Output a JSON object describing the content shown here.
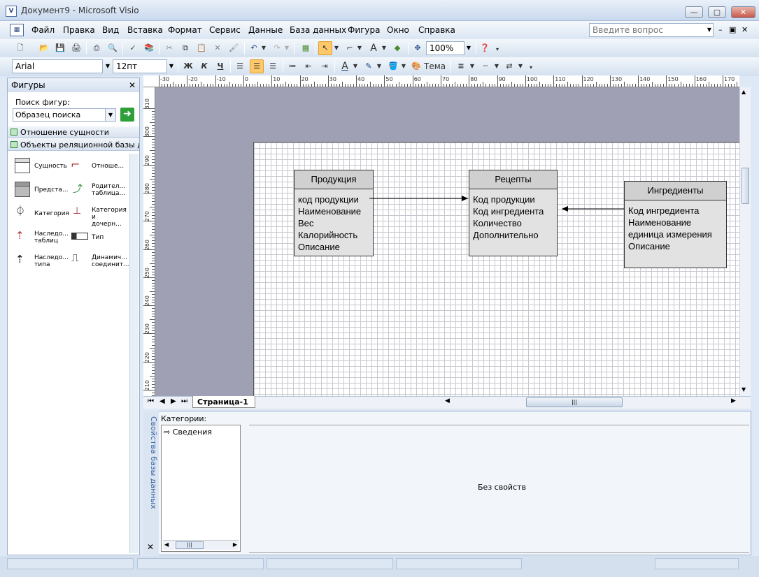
{
  "window": {
    "title": "Документ9 - Microsoft Visio",
    "min": "—",
    "max": "▢",
    "close": "✕"
  },
  "menu": {
    "items": [
      "Файл",
      "Правка",
      "Вид",
      "Вставка",
      "Формат",
      "Сервис",
      "Данные",
      "База данных",
      "Фигура",
      "Окно",
      "Справка"
    ],
    "help_placeholder": "Введите вопрос"
  },
  "toolbar": {
    "zoom": "100%"
  },
  "format_toolbar": {
    "font": "Arial",
    "size": "12пт",
    "bold": "Ж",
    "italic": "К",
    "underline": "Ч",
    "theme": "Тема"
  },
  "shapes_panel": {
    "title": "Фигуры",
    "search_label": "Поиск фигур:",
    "search_value": "Образец поиска",
    "stencils": [
      "Отношение сущности",
      "Объекты реляционной базы да..."
    ],
    "items": [
      [
        "Сущность",
        "Отноше..."
      ],
      [
        "Предста...",
        "Родител... таблица..."
      ],
      [
        "Категория",
        "Категория и дочерн..."
      ],
      [
        "Наследо... таблиц",
        "Тип"
      ],
      [
        "Наследо... типа",
        "Динамич... соединит..."
      ]
    ]
  },
  "ruler": {
    "h": [
      "-30",
      "-20",
      "-10",
      "0",
      "10",
      "20",
      "30",
      "40",
      "50",
      "60",
      "70",
      "80",
      "90",
      "100",
      "110",
      "120",
      "130",
      "140",
      "150",
      "160",
      "170"
    ],
    "v": [
      "310",
      "300",
      "290",
      "280",
      "270",
      "260",
      "250",
      "240",
      "230",
      "220",
      "210"
    ]
  },
  "diagram": {
    "entities": [
      {
        "name": "Продукция",
        "fields": [
          "код продукции",
          "Наименование",
          "Вес",
          "Калорийность",
          "Описание"
        ]
      },
      {
        "name": "Рецепты",
        "fields": [
          "Код продукции",
          "Код ингредиента",
          "Количество",
          "Дополнительно"
        ]
      },
      {
        "name": "Ингредиенты",
        "fields": [
          "Код ингредиента",
          "Наименование",
          "единица измерения",
          "Описание"
        ]
      }
    ]
  },
  "page_tab": "Страница-1",
  "db_properties": {
    "vertical_title": "Свойства базы данных",
    "categories_label": "Категории:",
    "category": "Сведения",
    "no_props": "Без свойств"
  },
  "colors": {
    "canvas": "#a0a0b4",
    "accent": "#ffc96a"
  }
}
